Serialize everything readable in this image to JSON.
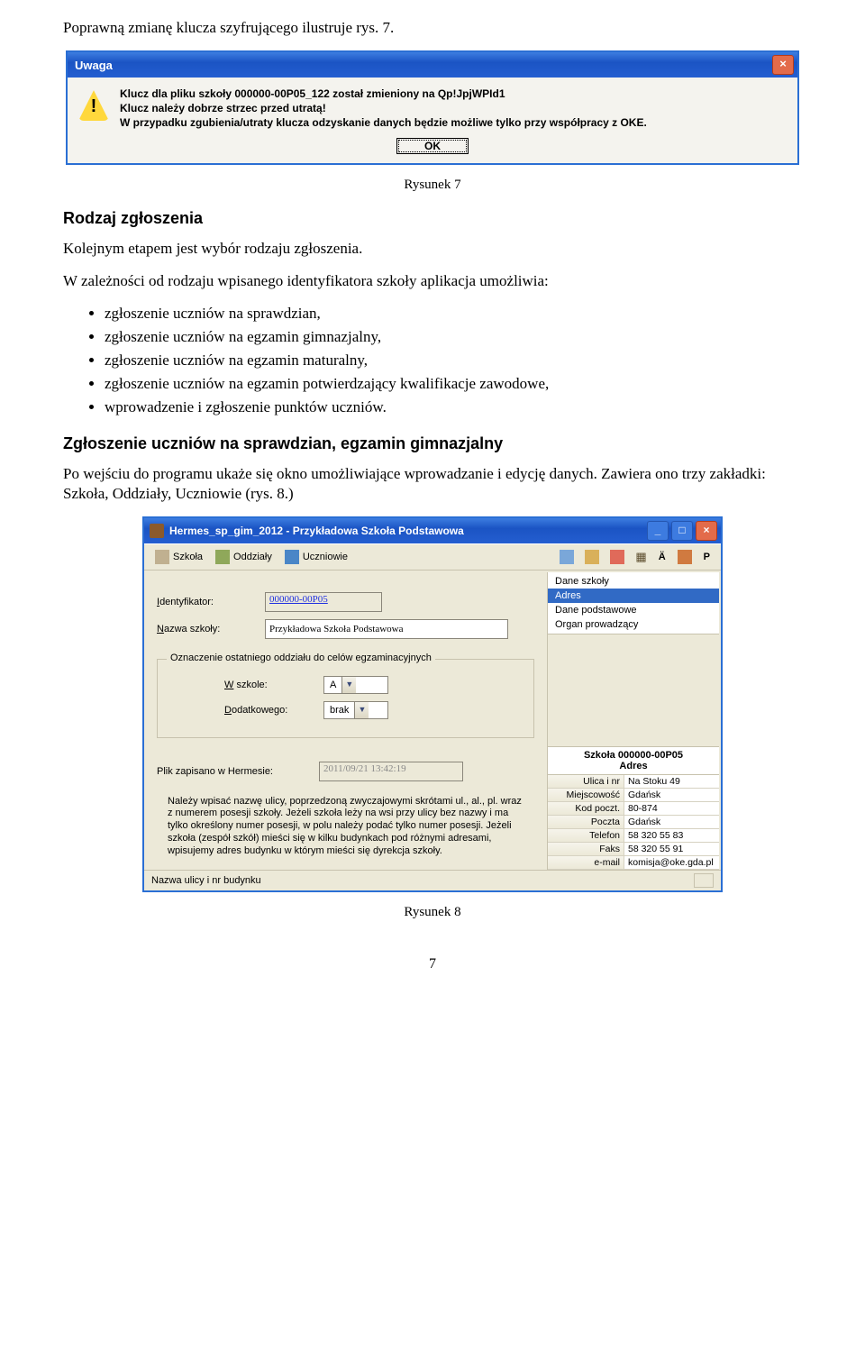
{
  "intro_line": "Poprawną zmianę klucza szyfrującego ilustruje rys. 7.",
  "dlg1": {
    "title": "Uwaga",
    "line1": "Klucz dla pliku szkoły 000000-00P05_122 został zmieniony na Qp!JpjWPId1",
    "line2": "Klucz należy dobrze strzec przed utratą!",
    "line3": "W przypadku zgubienia/utraty klucza odzyskanie danych będzie możliwe tylko przy współpracy z OKE.",
    "ok": "OK"
  },
  "fig7": "Rysunek 7",
  "section1": "Rodzaj zgłoszenia",
  "p1": "Kolejnym etapem jest wybór rodzaju zgłoszenia.",
  "p2": "W zależności od rodzaju wpisanego identyfikatora szkoły aplikacja umożliwia:",
  "bullets": [
    "zgłoszenie uczniów na sprawdzian,",
    "zgłoszenie uczniów na egzamin gimnazjalny,",
    "zgłoszenie uczniów na egzamin maturalny,",
    "zgłoszenie uczniów na egzamin potwierdzający kwalifikacje zawodowe,",
    "wprowadzenie i zgłoszenie punktów uczniów."
  ],
  "section2": "Zgłoszenie uczniów na sprawdzian, egzamin gimnazjalny",
  "p3": "Po wejściu do programu ukaże się okno umożliwiające wprowadzanie i edycję danych. Zawiera ono trzy zakładki: Szkoła, Oddziały, Uczniowie (rys. 8.)",
  "app": {
    "title": "Hermes_sp_gim_2012 - Przykładowa Szkoła Podstawowa",
    "toolbar": {
      "szkola": "Szkoła",
      "oddzialy": "Oddziały",
      "uczniowie": "Uczniowie"
    },
    "tb_right": {
      "a": "Ä",
      "p": "P"
    },
    "form": {
      "ident_label": "Identyfikator:",
      "ident_value": "000000-00P05",
      "nazwa_label": "Nazwa szkoły:",
      "nazwa_value": "Przykładowa Szkoła Podstawowa",
      "fieldset_legend": "Oznaczenie ostatniego oddziału do celów egzaminacyjnych",
      "wszkole_label": "W szkole:",
      "wszkole_value": "A",
      "dodatk_label": "Dodatkowego:",
      "dodatk_value": "brak",
      "plik_label": "Plik zapisano w Hermesie:",
      "plik_value": "2011/09/21 13:42:19"
    },
    "menu": {
      "m1": "Dane szkoły",
      "m2": "Adres",
      "m3": "Dane podstawowe",
      "m4": "Organ prowadzący"
    },
    "addr_title1": "Szkoła 000000-00P05",
    "addr_title2": "Adres",
    "addr": [
      {
        "k": "Ulica i nr",
        "v": "Na Stoku 49"
      },
      {
        "k": "Miejscowość",
        "v": "Gdańsk"
      },
      {
        "k": "Kod poczt.",
        "v": "80-874"
      },
      {
        "k": "Poczta",
        "v": "Gdańsk"
      },
      {
        "k": "Telefon",
        "v": "58 320 55 83"
      },
      {
        "k": "Faks",
        "v": "58 320 55 91"
      },
      {
        "k": "e-mail",
        "v": "komisja@oke.gda.pl"
      }
    ],
    "note": "Należy wpisać nazwę ulicy, poprzedzoną zwyczajowymi skrótami ul., al., pl. wraz z numerem posesji szkoły. Jeżeli szkoła leży na wsi przy ulicy bez nazwy i ma tylko określony numer posesji, w polu należy podać tylko numer posesji. Jeżeli szkoła (zespół szkół) mieści się w kilku budynkach pod różnymi adresami, wpisujemy adres budynku w którym mieści się dyrekcja szkoły.",
    "status": "Nazwa ulicy i nr budynku"
  },
  "fig8": "Rysunek 8",
  "pagenum": "7"
}
